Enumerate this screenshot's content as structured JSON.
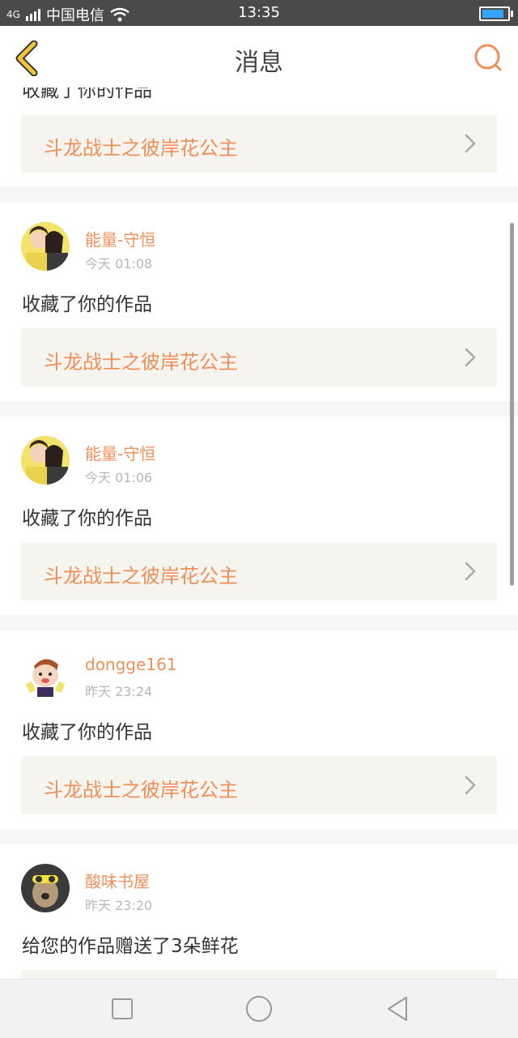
{
  "status_bar": {
    "network": "4G",
    "carrier": "中国电信",
    "time": "13:35",
    "icons": [
      "signal-icon",
      "wifi-icon",
      "battery-icon"
    ],
    "battery_level": 0.85
  },
  "header": {
    "title": "消息",
    "back_icon": "chevron-left-icon",
    "search_icon": "search-icon"
  },
  "partial_top": {
    "action": "收藏了你的作品",
    "work_title": "斗龙战士之彼岸花公主"
  },
  "messages": [
    {
      "username": "能量-守恒",
      "time": "今天 01:08",
      "action": "收藏了你的作品",
      "work_title": "斗龙战士之彼岸花公主"
    },
    {
      "username": "能量-守恒",
      "time": "今天 01:06",
      "action": "收藏了你的作品",
      "work_title": "斗龙战士之彼岸花公主"
    },
    {
      "username": "dongge161",
      "time": "昨天 23:24",
      "action": "收藏了你的作品",
      "work_title": "斗龙战士之彼岸花公主"
    },
    {
      "username": "酸味书屋",
      "time": "昨天 23:20",
      "action": "给您的作品赠送了3朵鲜花",
      "work_title": ""
    }
  ],
  "colors": {
    "accent": "#f08f5a",
    "work_bg": "#f5f4ee",
    "status_bar_bg": "#4a4a4a",
    "back_arrow": "#f2c63a"
  },
  "nav_bar": {
    "icons": [
      "square-icon",
      "circle-icon",
      "triangle-back-icon"
    ]
  }
}
